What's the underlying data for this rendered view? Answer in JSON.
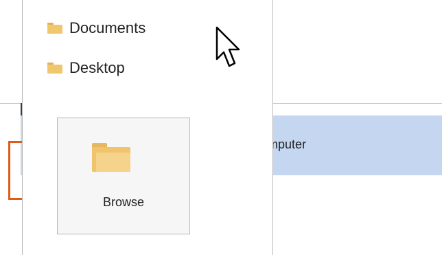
{
  "dropdown": {
    "recent_items": [
      {
        "label": "Documents",
        "icon": "folder-icon"
      },
      {
        "label": "Desktop",
        "icon": "folder-icon"
      }
    ],
    "browse": {
      "label": "Browse",
      "icon": "folder-icon"
    }
  },
  "list": {
    "selected_row_label": "omputer"
  },
  "colors": {
    "selection": "#c5d7f0",
    "focus_marker": "#e05a1a",
    "folder": "#f0c46c"
  }
}
